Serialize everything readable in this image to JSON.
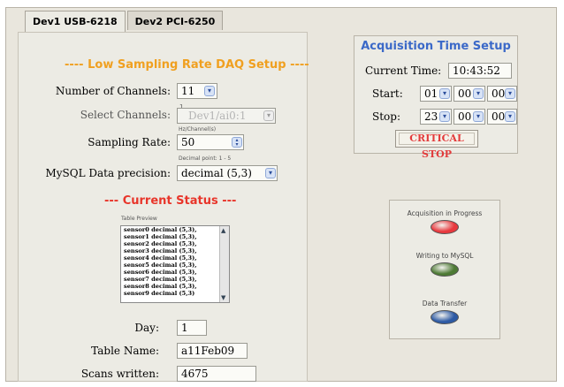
{
  "tabs": [
    {
      "label": "Dev1 USB-6218",
      "active": true
    },
    {
      "label": "Dev2 PCI-6250",
      "active": false
    }
  ],
  "setup": {
    "title": "---- Low Sampling Rate DAQ Setup ----",
    "channels_label": "Number of Channels:",
    "channels_value": "11",
    "select_label": "Select Channels:",
    "select_value": "Dev1/ai0:1",
    "select_index": "1",
    "rate_label": "Sampling Rate:",
    "rate_unit": "Hz/Channel(s)",
    "rate_value": "50",
    "precision_hint": "Decimal point: 1 - 5",
    "precision_label": "MySQL Data precision:",
    "precision_value": "decimal (5,3)"
  },
  "status": {
    "title": "--- Current Status ---",
    "preview_label": "Table Preview",
    "preview_rows": [
      "sensor0 decimal (5,3),",
      "sensor1 decimal (5,3),",
      "sensor2 decimal (5,3),",
      "sensor3 decimal (5,3),",
      "sensor4 decimal (5,3),",
      "sensor5 decimal (5,3),",
      "sensor6 decimal (5,3),",
      "sensor7 decimal (5,3),",
      "sensor8 decimal (5,3),",
      "sensor9 decimal (5,3)"
    ],
    "day_label": "Day:",
    "day_value": "1",
    "table_label": "Table Name:",
    "table_value": "a11Feb09",
    "scans_label": "Scans written:",
    "scans_value": "4675"
  },
  "acquisition": {
    "title": "Acquisition Time Setup",
    "current_label": "Current Time:",
    "current_value": "10:43:52",
    "start_label": "Start:",
    "start": [
      "01",
      "00",
      "00"
    ],
    "stop_label": "Stop:",
    "stop": [
      "23",
      "00",
      "00"
    ],
    "critical_label": "CRITICAL STOP"
  },
  "indicators": [
    {
      "label": "Acquisition in Progress",
      "color": "#e8383d"
    },
    {
      "label": "Writing to MySQL",
      "color": "#4d7a34"
    },
    {
      "label": "Data Transfer",
      "color": "#2d5aa4"
    }
  ]
}
